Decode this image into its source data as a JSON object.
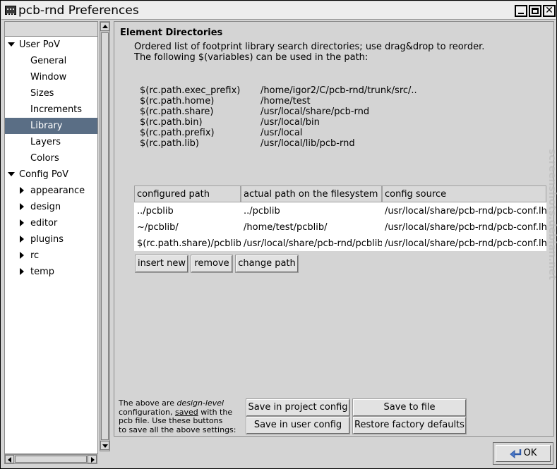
{
  "window": {
    "title": "pcb-rnd Preferences",
    "ok_label": "OK"
  },
  "sidebar": {
    "items": [
      {
        "label": "User PoV",
        "level": 0,
        "expanded": true
      },
      {
        "label": "General",
        "level": 1
      },
      {
        "label": "Window",
        "level": 1
      },
      {
        "label": "Sizes",
        "level": 1
      },
      {
        "label": "Increments",
        "level": 1
      },
      {
        "label": "Library",
        "level": 1,
        "selected": true
      },
      {
        "label": "Layers",
        "level": 1
      },
      {
        "label": "Colors",
        "level": 1
      },
      {
        "label": "Config PoV",
        "level": 0,
        "expanded": true
      },
      {
        "label": "appearance",
        "level": 1,
        "collapsed": true
      },
      {
        "label": "design",
        "level": 1,
        "collapsed": true
      },
      {
        "label": "editor",
        "level": 1,
        "collapsed": true
      },
      {
        "label": "plugins",
        "level": 1,
        "collapsed": true
      },
      {
        "label": "rc",
        "level": 1,
        "collapsed": true
      },
      {
        "label": "temp",
        "level": 1,
        "collapsed": true
      }
    ]
  },
  "main": {
    "section_title": "Element Directories",
    "desc_line1": "Ordered list of footprint library search directories; use drag&drop to reorder.",
    "desc_line2": "The following $(variables) can be used in the path:",
    "variables": [
      {
        "name": "$(rc.path.exec_prefix)",
        "path": "/home/igor2/C/pcb-rnd/trunk/src/.."
      },
      {
        "name": "$(rc.path.home)",
        "path": "/home/test"
      },
      {
        "name": "$(rc.path.share)",
        "path": "/usr/local/share/pcb-rnd"
      },
      {
        "name": "$(rc.path.bin)",
        "path": "/usr/local/bin"
      },
      {
        "name": "$(rc.path.prefix)",
        "path": "/usr/local"
      },
      {
        "name": "$(rc.path.lib)",
        "path": "/usr/local/lib/pcb-rnd"
      }
    ],
    "table": {
      "columns": [
        "configured path",
        "actual path on the filesystem",
        "config source"
      ],
      "rows": [
        [
          "../pcblib",
          "../pcblib",
          "/usr/local/share/pcb-rnd/pcb-conf.lht"
        ],
        [
          "~/pcblib/",
          "/home/test/pcblib/",
          "/usr/local/share/pcb-rnd/pcb-conf.lht"
        ],
        [
          "$(rc.path.share)/pcblib",
          "/usr/local/share/pcb-rnd/pcblib",
          "/usr/local/share/pcb-rnd/pcb-conf.lht"
        ]
      ]
    },
    "buttons": {
      "insert": "insert new",
      "remove": "remove",
      "change": "change path"
    },
    "note": {
      "p1": "The above are ",
      "em": "design-level",
      "p2": "configuration, ",
      "u": "saved",
      "p3": " with the",
      "p4": "pcb file. Use these buttons",
      "p5": "to save all the above settings:"
    },
    "save_buttons": {
      "project": "Save in project config",
      "user": "Save in user config",
      "file": "Save to file",
      "restore": "Restore factory defaults"
    }
  },
  "watermark": "screenshots.debian.net",
  "colors": {
    "selection": "#5a6e85",
    "accent_icon": "#4a78c8"
  }
}
